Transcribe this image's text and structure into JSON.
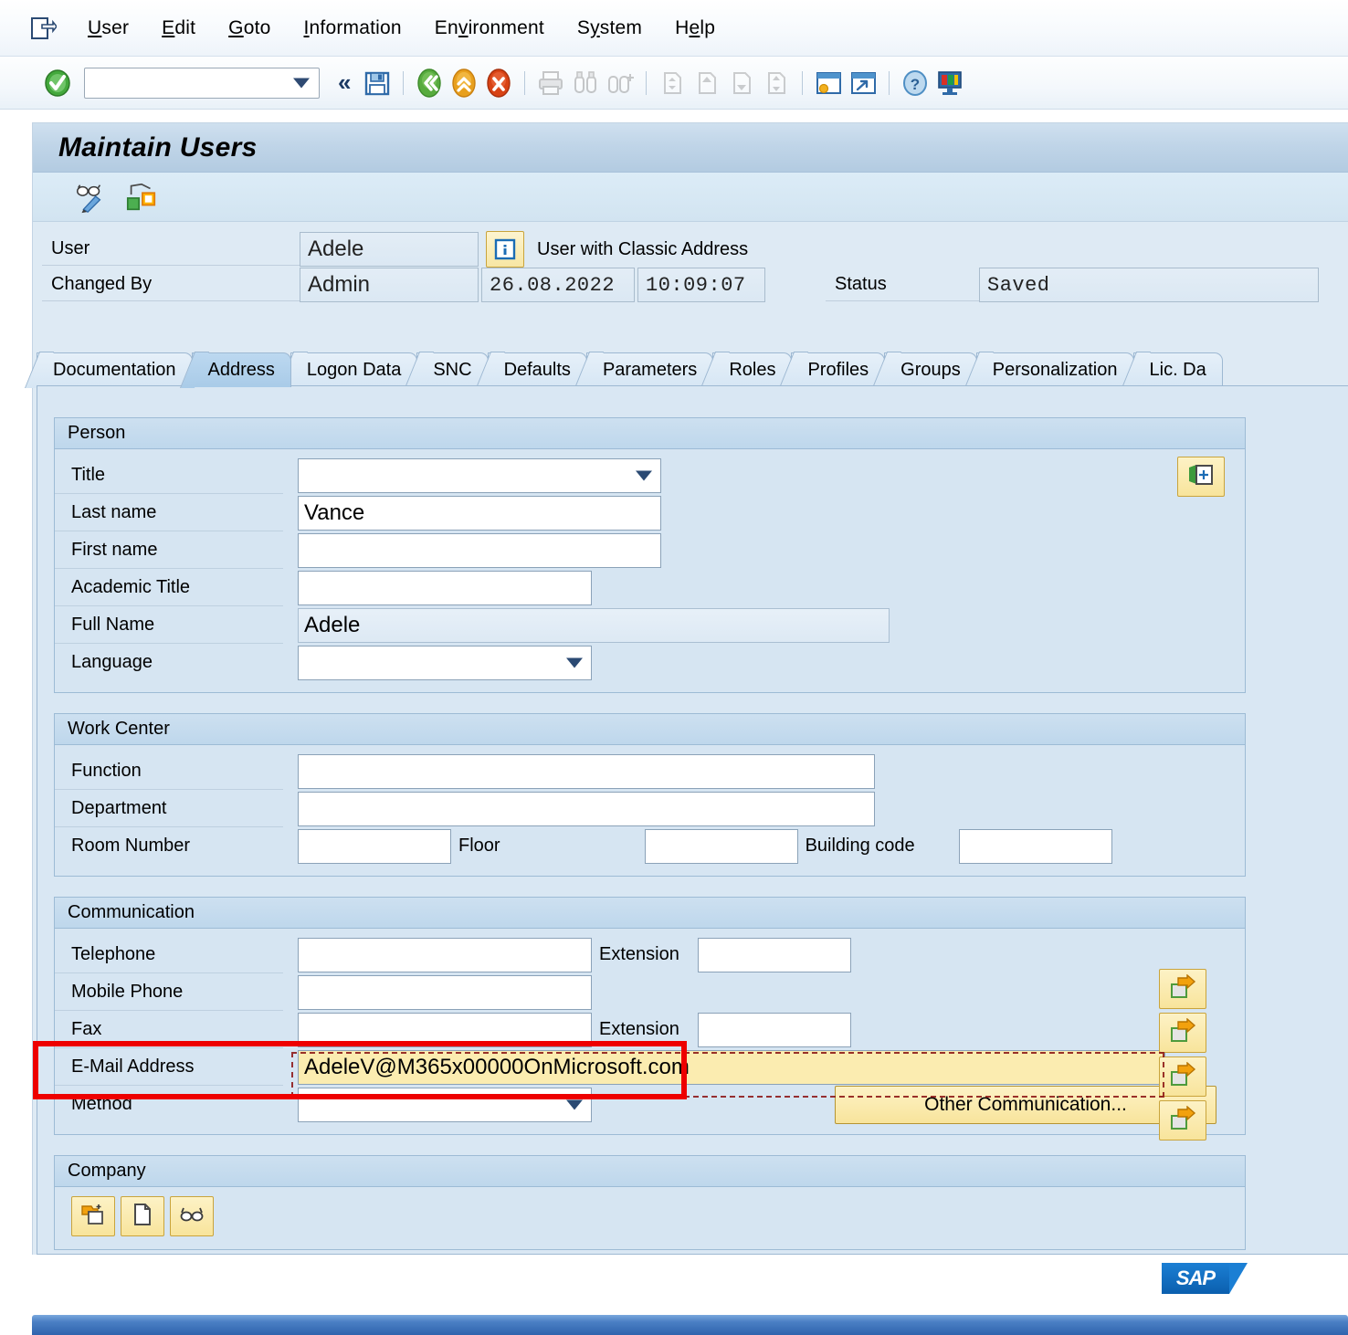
{
  "window": {
    "system_icon": "session-icon"
  },
  "menubar": {
    "items": [
      {
        "label": "User",
        "pre": "",
        "acc": "U",
        "post": "ser"
      },
      {
        "label": "Edit",
        "pre": "",
        "acc": "E",
        "post": "dit"
      },
      {
        "label": "Goto",
        "pre": "",
        "acc": "G",
        "post": "oto"
      },
      {
        "label": "Information",
        "pre": "",
        "acc": "I",
        "post": "nformation"
      },
      {
        "label": "Environment",
        "pre": "En",
        "acc": "v",
        "post": "ironment"
      },
      {
        "label": "System",
        "pre": "S",
        "acc": "y",
        "post": "stem"
      },
      {
        "label": "Help",
        "pre": "H",
        "acc": "e",
        "post": "lp"
      }
    ]
  },
  "toolbar": {
    "enter_icon": "green-check-enter-icon",
    "command_field": {
      "value": "",
      "placeholder": ""
    },
    "collapse_label": "«",
    "buttons": [
      {
        "name": "save-button",
        "icon": "save-floppy-icon",
        "enabled": true
      },
      {
        "name": "back-button",
        "icon": "back-green-icon",
        "enabled": true
      },
      {
        "name": "exit-button",
        "icon": "up-yellow-icon",
        "enabled": true
      },
      {
        "name": "cancel-button",
        "icon": "cancel-red-icon",
        "enabled": true
      },
      {
        "name": "print-button",
        "icon": "print-icon",
        "enabled": false
      },
      {
        "name": "find-button",
        "icon": "binoculars-find-icon",
        "enabled": false
      },
      {
        "name": "find-next-button",
        "icon": "binoculars-plus-icon",
        "enabled": false
      },
      {
        "name": "first-page-button",
        "icon": "first-page-icon",
        "enabled": false
      },
      {
        "name": "previous-page-button",
        "icon": "previous-page-icon",
        "enabled": false
      },
      {
        "name": "next-page-button",
        "icon": "next-page-icon",
        "enabled": false
      },
      {
        "name": "last-page-button",
        "icon": "last-page-icon",
        "enabled": false
      },
      {
        "name": "create-session-button",
        "icon": "new-session-icon",
        "enabled": true
      },
      {
        "name": "create-shortcut-button",
        "icon": "shortcut-icon",
        "enabled": true
      },
      {
        "name": "help-button",
        "icon": "help-question-icon",
        "enabled": true
      },
      {
        "name": "customize-button",
        "icon": "customize-monitor-icon",
        "enabled": true
      }
    ]
  },
  "screen": {
    "title": "Maintain Users",
    "app_toolbar": [
      {
        "name": "display-change-button",
        "icon": "glasses-pencil-icon"
      },
      {
        "name": "measurement-button",
        "icon": "measurement-icon"
      }
    ]
  },
  "header": {
    "user_label": "User",
    "user_value": "Adele",
    "info_icon": "info-i-icon",
    "info_text": "User with Classic Address",
    "changed_by_label": "Changed By",
    "changed_by_value": "Admin",
    "changed_date": "26.08.2022",
    "changed_time": "10:09:07",
    "status_label": "Status",
    "status_value": "Saved"
  },
  "tabs": [
    {
      "label": "Documentation",
      "active": false
    },
    {
      "label": "Address",
      "active": true
    },
    {
      "label": "Logon Data",
      "active": false
    },
    {
      "label": "SNC",
      "active": false
    },
    {
      "label": "Defaults",
      "active": false
    },
    {
      "label": "Parameters",
      "active": false
    },
    {
      "label": "Roles",
      "active": false
    },
    {
      "label": "Profiles",
      "active": false
    },
    {
      "label": "Groups",
      "active": false
    },
    {
      "label": "Personalization",
      "active": false
    },
    {
      "label": "Lic. Da",
      "active": false
    }
  ],
  "person": {
    "legend": "Person",
    "title_label": "Title",
    "title_value": "",
    "last_name_label": "Last name",
    "last_name_value": "Vance",
    "first_name_label": "First name",
    "first_name_value": "",
    "academic_title_label": "Academic Title",
    "academic_title_value": "",
    "full_name_label": "Full Name",
    "full_name_value": "Adele",
    "language_label": "Language",
    "language_value": "",
    "new_entry_icon": "new-address-entry-icon"
  },
  "work_center": {
    "legend": "Work Center",
    "function_label": "Function",
    "function_value": "",
    "department_label": "Department",
    "department_value": "",
    "room_number_label": "Room Number",
    "room_number_value": "",
    "floor_label": "Floor",
    "floor_value": "",
    "building_code_label": "Building code",
    "building_code_value": ""
  },
  "communication": {
    "legend": "Communication",
    "telephone_label": "Telephone",
    "telephone_value": "",
    "telephone_ext_label": "Extension",
    "telephone_ext_value": "",
    "mobile_label": "Mobile Phone",
    "mobile_value": "",
    "fax_label": "Fax",
    "fax_value": "",
    "fax_ext_label": "Extension",
    "fax_ext_value": "",
    "email_label": "E-Mail Address",
    "email_value": "AdeleV@M365x00000OnMicrosoft.com",
    "method_label": "Method",
    "method_value": "",
    "other_communication_label": "Other Communication...",
    "detail_icon": "maintain-detail-arrow-icon"
  },
  "company": {
    "legend": "Company",
    "buttons": [
      {
        "name": "create-company-button",
        "icon": "create-folder-plus-icon"
      },
      {
        "name": "new-company-button",
        "icon": "blank-page-icon"
      },
      {
        "name": "display-company-button",
        "icon": "glasses-display-icon"
      }
    ]
  },
  "statusbar": {
    "logo_text": "SAP"
  },
  "annotation": {
    "highlight_target": "E-Mail Address field",
    "highlight_color": "#ee0000"
  }
}
